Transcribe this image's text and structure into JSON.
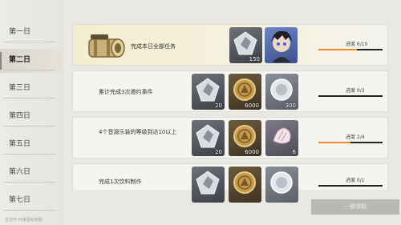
{
  "sidebar": {
    "days": [
      "第一日",
      "第二日",
      "第三日",
      "第四日",
      "第五日",
      "第六日",
      "第七日"
    ],
    "active_index": 1,
    "footer_text": "生活节·日常活动奖励"
  },
  "tasks": [
    {
      "description": "完成本日全部任务",
      "rewards": [
        {
          "icon": "crystal-icon",
          "qty": "150"
        },
        {
          "icon": "character-portrait-icon",
          "qty": ""
        }
      ],
      "progress_label": "进度 6/10",
      "progress_fraction": 0.6
    },
    {
      "description": "累计完成3次邀约事件",
      "rewards": [
        {
          "icon": "crystal-icon",
          "qty": "20"
        },
        {
          "icon": "coin-icon",
          "qty": "6000"
        },
        {
          "icon": "gem-icon",
          "qty": "300"
        }
      ],
      "progress_label": "进度 0/3",
      "progress_fraction": 0.0
    },
    {
      "description": "4个音源乐装的等级到达10以上",
      "rewards": [
        {
          "icon": "crystal-icon",
          "qty": "20"
        },
        {
          "icon": "coin-icon",
          "qty": "6000"
        },
        {
          "icon": "shell-icon",
          "qty": "6"
        }
      ],
      "progress_label": "进度 2/4",
      "progress_fraction": 0.5
    },
    {
      "description": "完成1次饮料制作",
      "rewards": [
        {
          "icon": "crystal-icon",
          "qty": ""
        },
        {
          "icon": "coin-icon",
          "qty": ""
        },
        {
          "icon": "gem-icon",
          "qty": ""
        }
      ],
      "progress_label": "进度 0/1",
      "progress_fraction": 0.0
    }
  ],
  "claim_all_button": "一键领取",
  "colors": {
    "progress_fill": "#f08a2a",
    "progress_track": "#222222",
    "highlight_row": "#f3edd0"
  }
}
